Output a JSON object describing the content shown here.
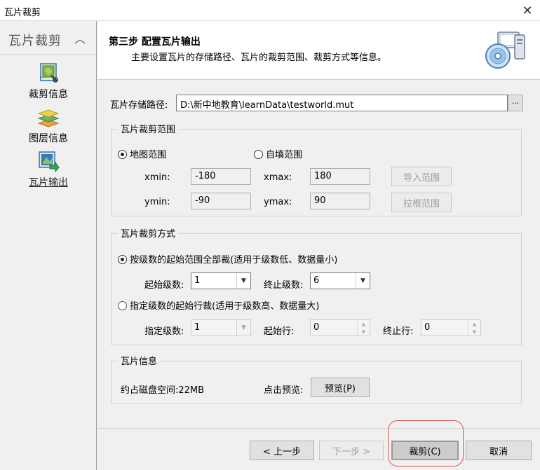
{
  "window": {
    "title": "瓦片裁剪"
  },
  "nav": {
    "title": "瓦片裁剪",
    "items": [
      {
        "label": "裁剪信息",
        "icon": "crop-map-icon"
      },
      {
        "label": "图层信息",
        "icon": "layers-icon"
      },
      {
        "label": "瓦片输出",
        "icon": "tile-export-icon"
      }
    ]
  },
  "header": {
    "title": "第三步 配置瓦片输出",
    "subtitle": "主要设置瓦片的存储路径、瓦片的裁剪范围、裁剪方式等信息。"
  },
  "path": {
    "label": "瓦片存储路径:",
    "value": "D:\\新中地教育\\learnData\\testworld.mut",
    "browse_label": "···"
  },
  "extent": {
    "group_title": "瓦片裁剪范围",
    "map_extent_label": "地图范围",
    "custom_extent_label": "自填范围",
    "xmin_label": "xmin:",
    "xmin": "-180",
    "xmax_label": "xmax:",
    "xmax": "180",
    "ymin_label": "ymin:",
    "ymin": "-90",
    "ymax_label": "ymax:",
    "ymax": "90",
    "import_label": "导入范围",
    "drag_label": "拉框范围"
  },
  "mode": {
    "group_title": "瓦片裁剪方式",
    "option1_label": "按级数的起始范围全部裁(适用于级数低、数据量小)",
    "start_level_label": "起始级数:",
    "start_level": "1",
    "end_level_label": "终止级数:",
    "end_level": "6",
    "option2_label": "指定级数的起始行裁(适用于级数高、数据量大)",
    "specified_level_label": "指定级数:",
    "specified_level": "1",
    "start_row_label": "起始行:",
    "start_row": "0",
    "end_row_label": "终止行:",
    "end_row": "0"
  },
  "info": {
    "group_title": "瓦片信息",
    "disk_label": "约占磁盘空间:22MB",
    "preview_prompt": "点击预览:",
    "preview_label": "预览(P)"
  },
  "buttons": {
    "prev_label": "< 上一步",
    "next_label": "下一步 >",
    "crop_label": "裁剪(C)",
    "cancel_label": "取消"
  },
  "colors": {
    "highlight": "#d9534f",
    "window_bg": "#f0f0f0"
  }
}
